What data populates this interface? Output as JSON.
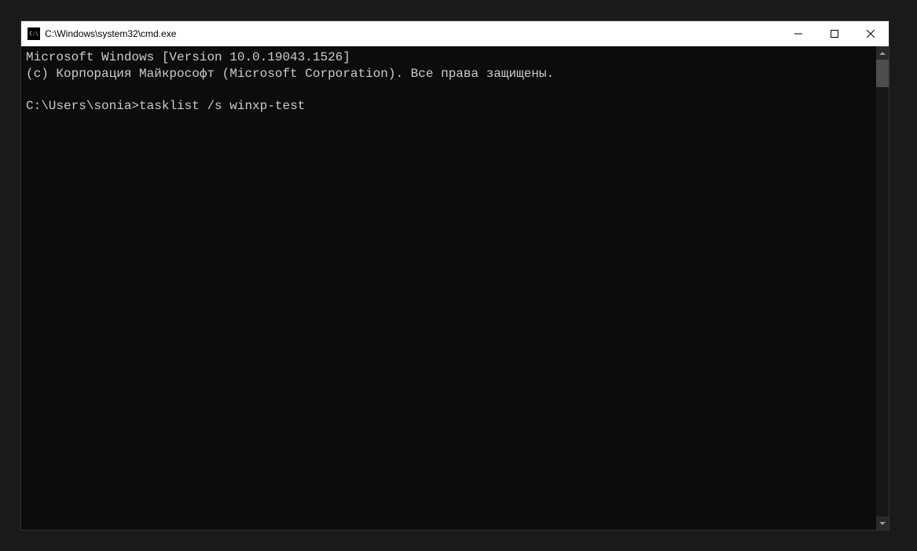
{
  "titlebar": {
    "icon_label": "C:\\",
    "title": "C:\\Windows\\system32\\cmd.exe"
  },
  "console": {
    "line1": "Microsoft Windows [Version 10.0.19043.1526]",
    "line2": "(c) Корпорация Майкрософт (Microsoft Corporation). Все права защищены.",
    "blank": "",
    "prompt": "C:\\Users\\sonia>",
    "command": "tasklist /s winxp-test"
  }
}
